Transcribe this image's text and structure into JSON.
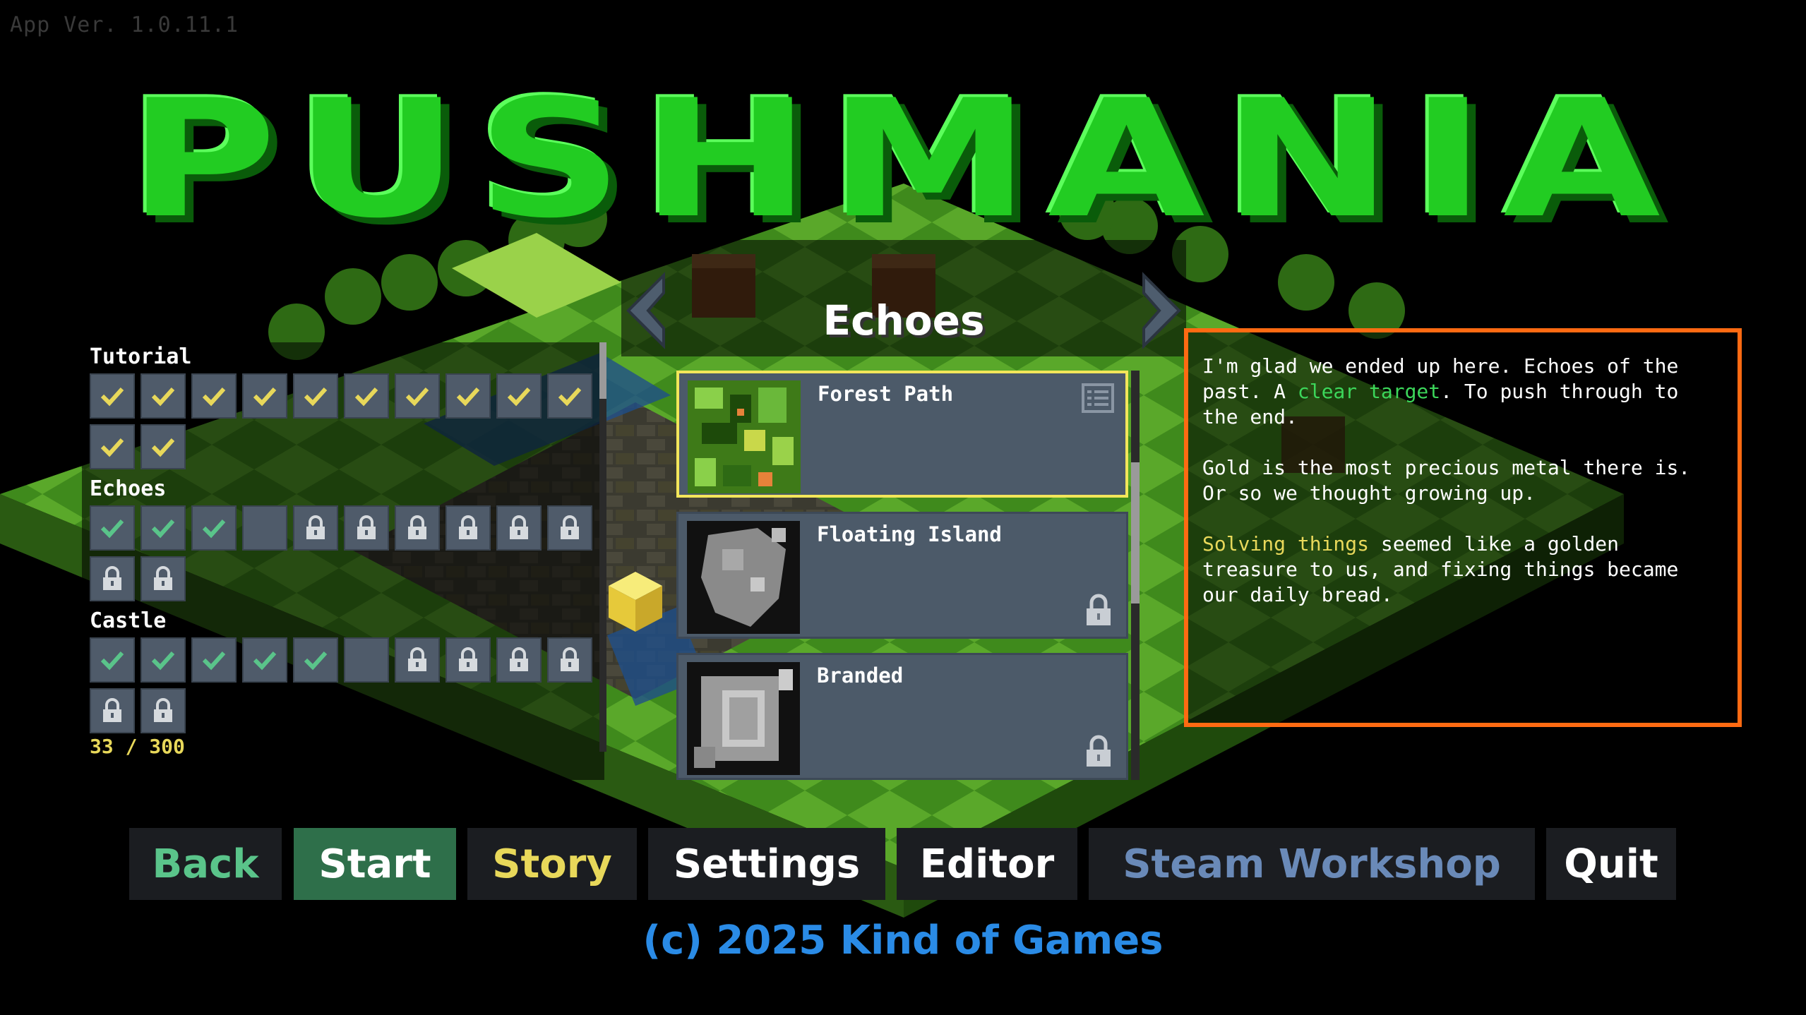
{
  "app_version": "App Ver. 1.0.11.1",
  "logo_text": "PUSHMANIA",
  "colors": {
    "logo": "#22cc22",
    "accent_orange": "#ff6a12",
    "check": "#e8d85a",
    "check_alt": "#5ac48a",
    "yellow_text": "#e8d85a",
    "copyright": "#2a8be6"
  },
  "progress": {
    "groups": [
      {
        "title": "Tutorial",
        "cells": [
          "done-yellow",
          "done-yellow",
          "done-yellow",
          "done-yellow",
          "done-yellow",
          "done-yellow",
          "done-yellow",
          "done-yellow",
          "done-yellow",
          "done-yellow",
          "done-yellow",
          "done-yellow"
        ]
      },
      {
        "title": "Echoes",
        "cells": [
          "done-green",
          "done-green",
          "done-green",
          "open",
          "locked",
          "locked",
          "locked",
          "locked",
          "locked",
          "locked",
          "locked",
          "locked"
        ]
      },
      {
        "title": "Castle",
        "cells": [
          "done-green",
          "done-green",
          "done-green",
          "done-green",
          "done-green",
          "open",
          "locked",
          "locked",
          "locked",
          "locked",
          "locked",
          "locked"
        ]
      }
    ],
    "count": "33 / 300"
  },
  "chapter": {
    "title": "Echoes",
    "prev_icon": "chevron-left-icon",
    "next_icon": "chevron-right-icon"
  },
  "levels": [
    {
      "name": "Forest Path",
      "selected": true,
      "locked": false,
      "icon": "notes-icon"
    },
    {
      "name": "Floating Island",
      "selected": false,
      "locked": true,
      "icon": "lock-icon"
    },
    {
      "name": "Branded",
      "selected": false,
      "locked": true,
      "icon": "lock-icon"
    }
  ],
  "story": {
    "p1_a": "I'm glad we ended up here. Echoes of the past. A ",
    "p1_hl": "clear target",
    "p1_b": ". To push through to the end.",
    "p2": "Gold is the most precious metal there is. Or so we thought growing up.",
    "p3_hl": "Solving things",
    "p3_b": " seemed like a golden treasure to us, and fixing things became our daily bread."
  },
  "menu": {
    "back": "Back",
    "start": "Start",
    "story": "Story",
    "settings": "Settings",
    "editor": "Editor",
    "workshop": "Steam Workshop",
    "quit": "Quit"
  },
  "copyright": "(c) 2025 Kind of Games"
}
